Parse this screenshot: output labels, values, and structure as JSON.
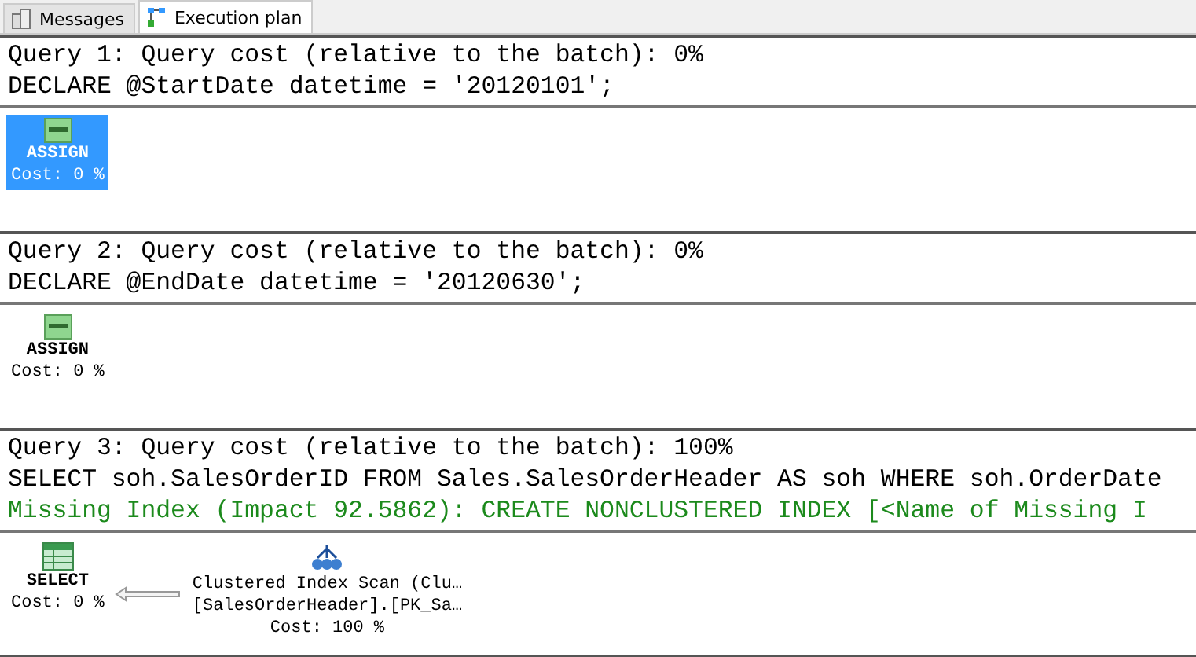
{
  "tabs": [
    {
      "label": "Messages",
      "selected": false
    },
    {
      "label": "Execution plan",
      "selected": true
    }
  ],
  "queries": [
    {
      "lines": [
        {
          "kind": "header",
          "text": "Query 1: Query cost (relative to the batch): 0%"
        },
        {
          "kind": "sql",
          "text": "DECLARE @StartDate datetime = '20120101';"
        }
      ],
      "nodes": [
        {
          "kind": "tsql",
          "name": "ASSIGN",
          "cost": "Cost: 0 %",
          "selected": true
        }
      ]
    },
    {
      "lines": [
        {
          "kind": "header",
          "text": "Query 2: Query cost (relative to the batch): 0%"
        },
        {
          "kind": "sql",
          "text": "DECLARE @EndDate datetime = '20120630';"
        }
      ],
      "nodes": [
        {
          "kind": "tsql",
          "name": "ASSIGN",
          "cost": "Cost: 0 %",
          "selected": false
        }
      ]
    },
    {
      "lines": [
        {
          "kind": "header",
          "text": "Query 3: Query cost (relative to the batch): 100%"
        },
        {
          "kind": "sql",
          "text": "SELECT soh.SalesOrderID FROM Sales.SalesOrderHeader AS soh WHERE soh.OrderDate"
        },
        {
          "kind": "hint",
          "text": "Missing Index (Impact 92.5862): CREATE NONCLUSTERED INDEX [<Name of Missing I"
        }
      ],
      "nodes": [
        {
          "kind": "select",
          "name": "SELECT",
          "cost": "Cost: 0 %",
          "selected": false
        },
        {
          "kind": "scan",
          "details": [
            "Clustered Index Scan (Clu…",
            "[SalesOrderHeader].[PK_Sa…"
          ],
          "cost": "Cost: 100 %",
          "selected": false
        }
      ]
    }
  ]
}
